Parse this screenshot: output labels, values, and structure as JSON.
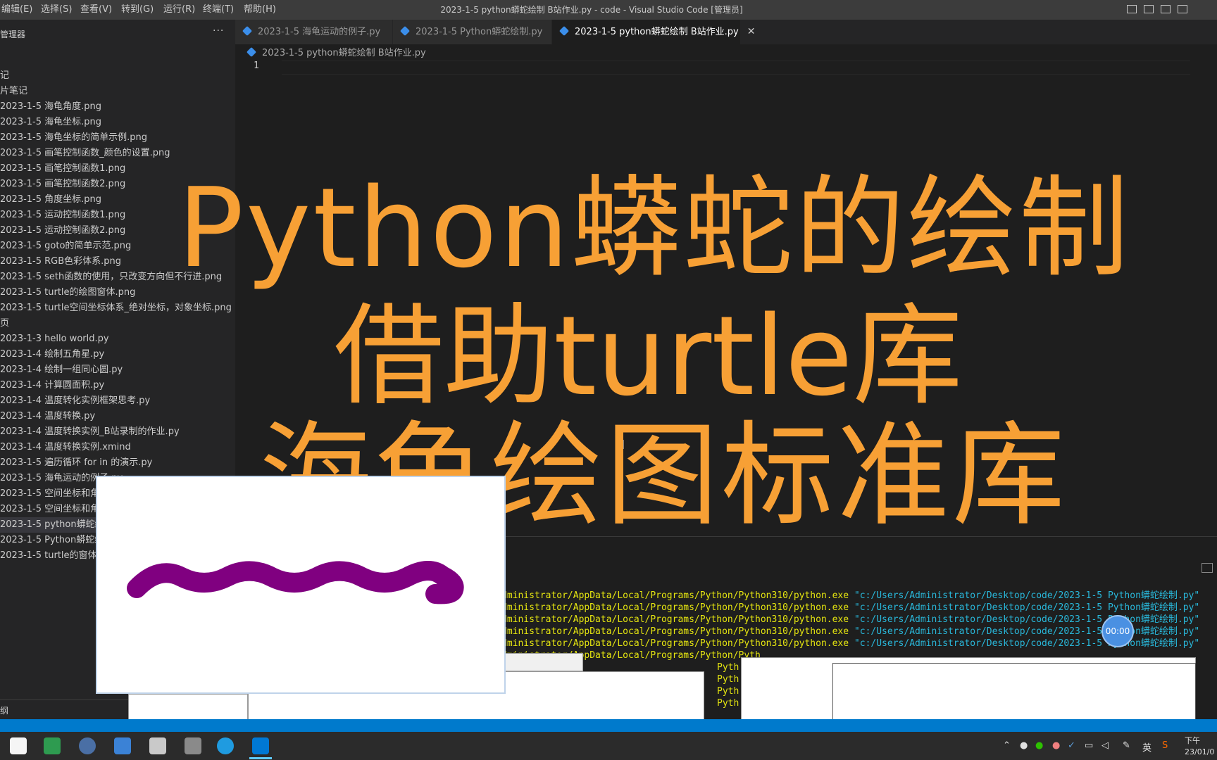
{
  "menu": [
    "编辑(E)",
    "选择(S)",
    "查看(V)",
    "转到(G)",
    "运行(R)",
    "终端(T)",
    "帮助(H)"
  ],
  "window_title": "2023-1-5 python蟒蛇绘制 B站作业.py - code - Visual Studio Code [管理员]",
  "sidebar": {
    "title": "管理器",
    "more": "···",
    "items": [
      {
        "label": "记",
        "active": false
      },
      {
        "label": "片笔记",
        "active": false
      },
      {
        "label": "2023-1-5 海龟角度.png",
        "active": false
      },
      {
        "label": "2023-1-5 海龟坐标.png",
        "active": false
      },
      {
        "label": "2023-1-5 海龟坐标的简单示例.png",
        "active": false
      },
      {
        "label": "2023-1-5 画笔控制函数_颜色的设置.png",
        "active": false
      },
      {
        "label": "2023-1-5 画笔控制函数1.png",
        "active": false
      },
      {
        "label": "2023-1-5 画笔控制函数2.png",
        "active": false
      },
      {
        "label": "2023-1-5 角度坐标.png",
        "active": false
      },
      {
        "label": "2023-1-5 运动控制函数1.png",
        "active": false
      },
      {
        "label": "2023-1-5 运动控制函数2.png",
        "active": false
      },
      {
        "label": "2023-1-5 goto的简单示范.png",
        "active": false
      },
      {
        "label": "2023-1-5 RGB色彩体系.png",
        "active": false
      },
      {
        "label": "2023-1-5 seth函数的使用，只改变方向但不行进.png",
        "active": false
      },
      {
        "label": "2023-1-5 turtle的绘图窗体.png",
        "active": false
      },
      {
        "label": "2023-1-5 turtle空间坐标体系_绝对坐标，对象坐标.png",
        "active": false
      },
      {
        "label": "页",
        "active": false
      },
      {
        "label": "2023-1-3 hello world.py",
        "active": false
      },
      {
        "label": "2023-1-4 绘制五角星.py",
        "active": false
      },
      {
        "label": "2023-1-4 绘制一组同心圆.py",
        "active": false
      },
      {
        "label": "2023-1-4 计算圆面积.py",
        "active": false
      },
      {
        "label": "2023-1-4 温度转化实例框架思考.py",
        "active": false
      },
      {
        "label": "2023-1-4 温度转换.py",
        "active": false
      },
      {
        "label": "2023-1-4 温度转换实例_B站录制的作业.py",
        "active": false
      },
      {
        "label": "2023-1-4 温度转换实例.xmind",
        "active": false
      },
      {
        "label": "2023-1-5 遍历循环 for in 的演示.py",
        "active": false
      },
      {
        "label": "2023-1-5 海龟运动的例子.py",
        "active": false
      },
      {
        "label": "2023-1-5 空间坐标和角度",
        "active": false
      },
      {
        "label": "2023-1-5 空间坐标和角度",
        "active": false
      },
      {
        "label": "2023-1-5 python蟒蛇绘制",
        "active": true
      },
      {
        "label": "2023-1-5 Python蟒蛇绘制",
        "active": false
      },
      {
        "label": "2023-1-5 turtle的窗体布局",
        "active": false
      }
    ],
    "bottom_label": "纲"
  },
  "tabs": [
    {
      "label": "2023-1-5 海龟运动的例子.py",
      "active": false
    },
    {
      "label": "2023-1-5 Python蟒蛇绘制.py",
      "active": false
    },
    {
      "label": "2023-1-5 python蟒蛇绘制 B站作业.py",
      "active": true
    }
  ],
  "tab_close": "✕",
  "breadcrumb": "2023-1-5 python蟒蛇绘制 B站作业.py",
  "editor": {
    "line_number": "1"
  },
  "overlay": {
    "line1": "Python蟒蛇的绘制",
    "line2": "借助turtle库",
    "line3": "海龟绘图标准库"
  },
  "terminal": {
    "lines": [
      {
        "exe": "dministrator/AppData/Local/Programs/Python/Python310/python.exe",
        "arg": "\"c:/Users/Administrator/Desktop/code/2023-1-5 Python蟒蛇绘制.py\""
      },
      {
        "exe": "dministrator/AppData/Local/Programs/Python/Python310/python.exe",
        "arg": "\"c:/Users/Administrator/Desktop/code/2023-1-5 Python蟒蛇绘制.py\""
      },
      {
        "exe": "dministrator/AppData/Local/Programs/Python/Python310/python.exe",
        "arg": "\"c:/Users/Administrator/Desktop/code/2023-1-5 Python蟒蛇绘制.py\""
      },
      {
        "exe": "dministrator/AppData/Local/Programs/Python/Python310/python.exe",
        "arg": "\"c:/Users/Administrator/Desktop/code/2023-1-5 Python蟒蛇绘制.py\""
      },
      {
        "exe": "dministrator/AppData/Local/Programs/Python/Python310/python.exe",
        "arg": "\"c:/Users/Administrator/Desktop/code/2023-1-5 Python蟒蛇绘制.py\""
      },
      {
        "exe": "dministrator/AppData/Local/Programs/Python/Pyth",
        "arg": ""
      },
      {
        "exe": "Pyth",
        "arg": ""
      },
      {
        "exe": "Pyth",
        "arg": ""
      },
      {
        "exe": "Pyth",
        "arg": ""
      },
      {
        "exe": "Pyth",
        "arg": ""
      }
    ]
  },
  "recorder_timer": "00:00",
  "tray": {
    "ime": "英",
    "time": "下午",
    "date": "23/01/0"
  },
  "colors": {
    "accent": "#007acc",
    "overlay": "#f7a035",
    "snake": "#800080"
  }
}
